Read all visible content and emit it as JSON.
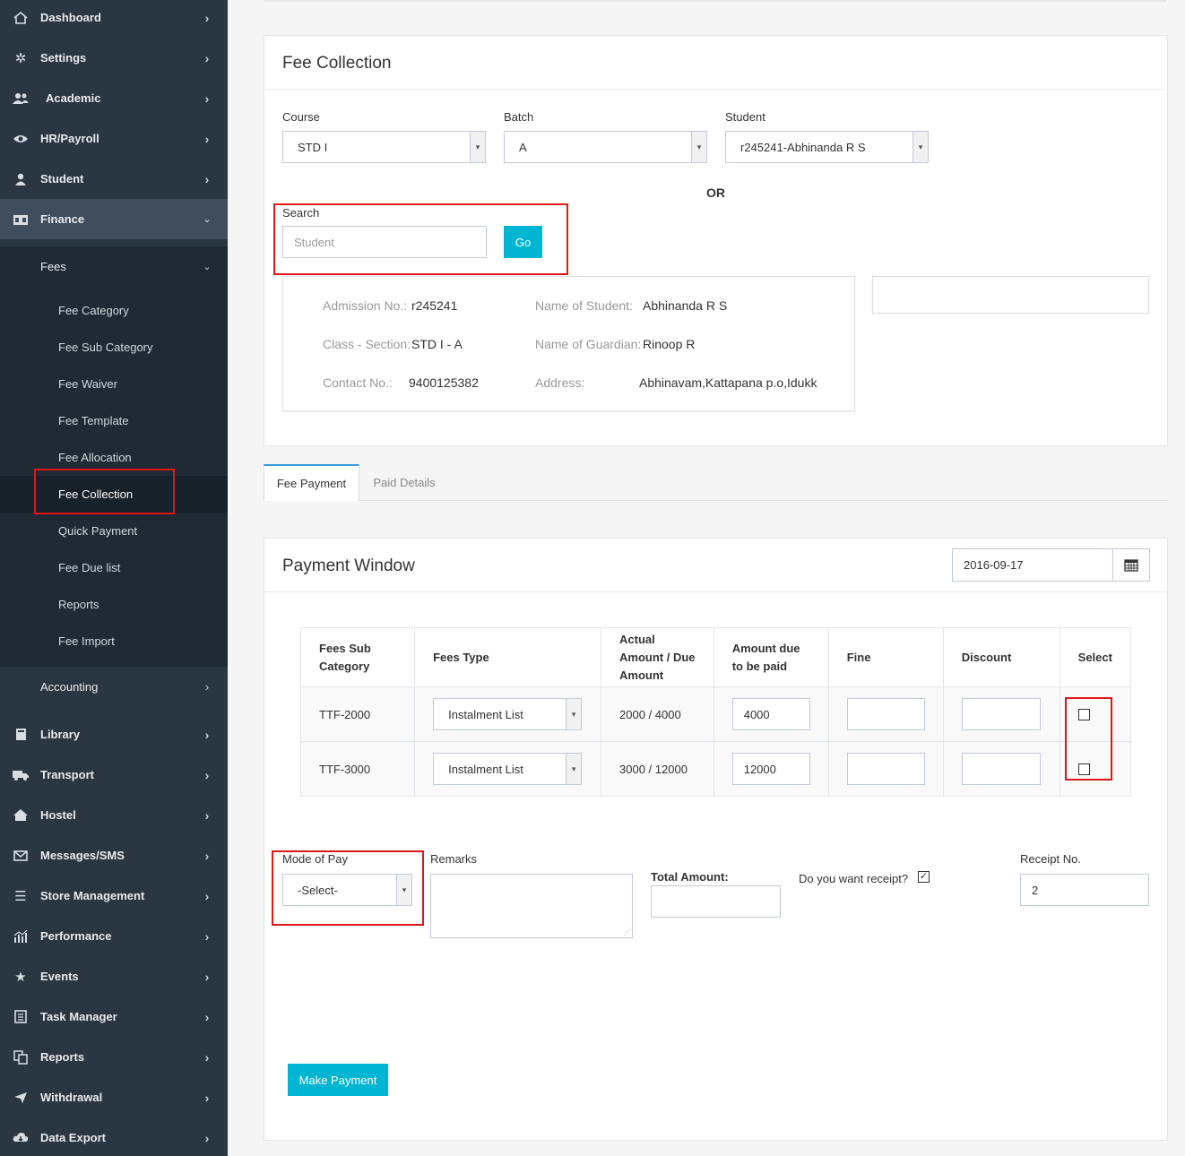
{
  "sidebar": {
    "top_items": [
      {
        "label": "Dashboard",
        "icon": "home-icon"
      },
      {
        "label": "Settings",
        "icon": "gears-icon"
      },
      {
        "label": "Academic",
        "icon": "users-icon"
      },
      {
        "label": "HR/Payroll",
        "icon": "eye-icon"
      },
      {
        "label": "Student",
        "icon": "user-icon"
      },
      {
        "label": "Finance",
        "icon": "bank-icon"
      }
    ],
    "fees_header": "Fees",
    "fees_items": [
      "Fee Category",
      "Fee Sub Category",
      "Fee Waiver",
      "Fee Template",
      "Fee Allocation",
      "Fee Collection",
      "Quick Payment",
      "Fee Due list",
      "Reports",
      "Fee Import"
    ],
    "accounting": "Accounting",
    "bottom_items": [
      {
        "label": "Library",
        "icon": "book-icon"
      },
      {
        "label": "Transport",
        "icon": "truck-icon"
      },
      {
        "label": "Hostel",
        "icon": "home-icon"
      },
      {
        "label": "Messages/SMS",
        "icon": "envelope-icon"
      },
      {
        "label": "Store Management",
        "icon": "list-icon"
      },
      {
        "label": "Performance",
        "icon": "chart-icon"
      },
      {
        "label": "Events",
        "icon": "star-icon"
      },
      {
        "label": "Task Manager",
        "icon": "task-icon"
      },
      {
        "label": "Reports",
        "icon": "copy-icon"
      },
      {
        "label": "Withdrawal",
        "icon": "send-icon"
      },
      {
        "label": "Data Export",
        "icon": "cloud-download-icon"
      }
    ]
  },
  "fee_collection": {
    "title": "Fee Collection",
    "course_label": "Course",
    "course_value": "STD I",
    "batch_label": "Batch",
    "batch_value": "A",
    "student_label": "Student",
    "student_value": "r245241-Abhinanda R S",
    "or_text": "OR",
    "search_label": "Search",
    "search_placeholder": "Student",
    "go_label": "Go",
    "info": {
      "admission_label": "Admission No.:",
      "admission_value": "r245241",
      "name_label": "Name of Student:",
      "name_value": "Abhinanda R S",
      "class_label": "Class - Section:",
      "class_value": "STD I - A",
      "guardian_label": "Name of Guardian:",
      "guardian_value": "Rinoop R",
      "contact_label": "Contact No.:",
      "contact_value": "9400125382",
      "address_label": "Address:",
      "address_value": "Abhinavam,Kattapana p.o,Idukk"
    }
  },
  "tabs": [
    "Fee Payment",
    "Paid Details"
  ],
  "payment_window": {
    "title": "Payment Window",
    "date": "2016-09-17",
    "columns": [
      "Fees Sub Category",
      "Fees Type",
      "Actual Amount / Due Amount",
      "Amount due to be paid",
      "Fine",
      "Discount",
      "Select"
    ],
    "rows": [
      {
        "sub_category": "TTF-2000",
        "fees_type": "Instalment List",
        "actual_due": "2000 / 4000",
        "amount_due": "4000",
        "fine": "",
        "discount": ""
      },
      {
        "sub_category": "TTF-3000",
        "fees_type": "Instalment List",
        "actual_due": "3000 / 12000",
        "amount_due": "12000",
        "fine": "",
        "discount": ""
      }
    ],
    "mode_label": "Mode of Pay",
    "mode_value": "-Select-",
    "remarks_label": "Remarks",
    "total_label": "Total Amount:",
    "total_value": "",
    "receipt_question": "Do you want receipt?",
    "receipt_no_label": "Receipt No.",
    "receipt_no_value": "2",
    "make_payment": "Make Payment"
  },
  "colors": {
    "sidebar": "#2b3643",
    "accent": "#00b5d1",
    "highlight": "#e01616"
  }
}
